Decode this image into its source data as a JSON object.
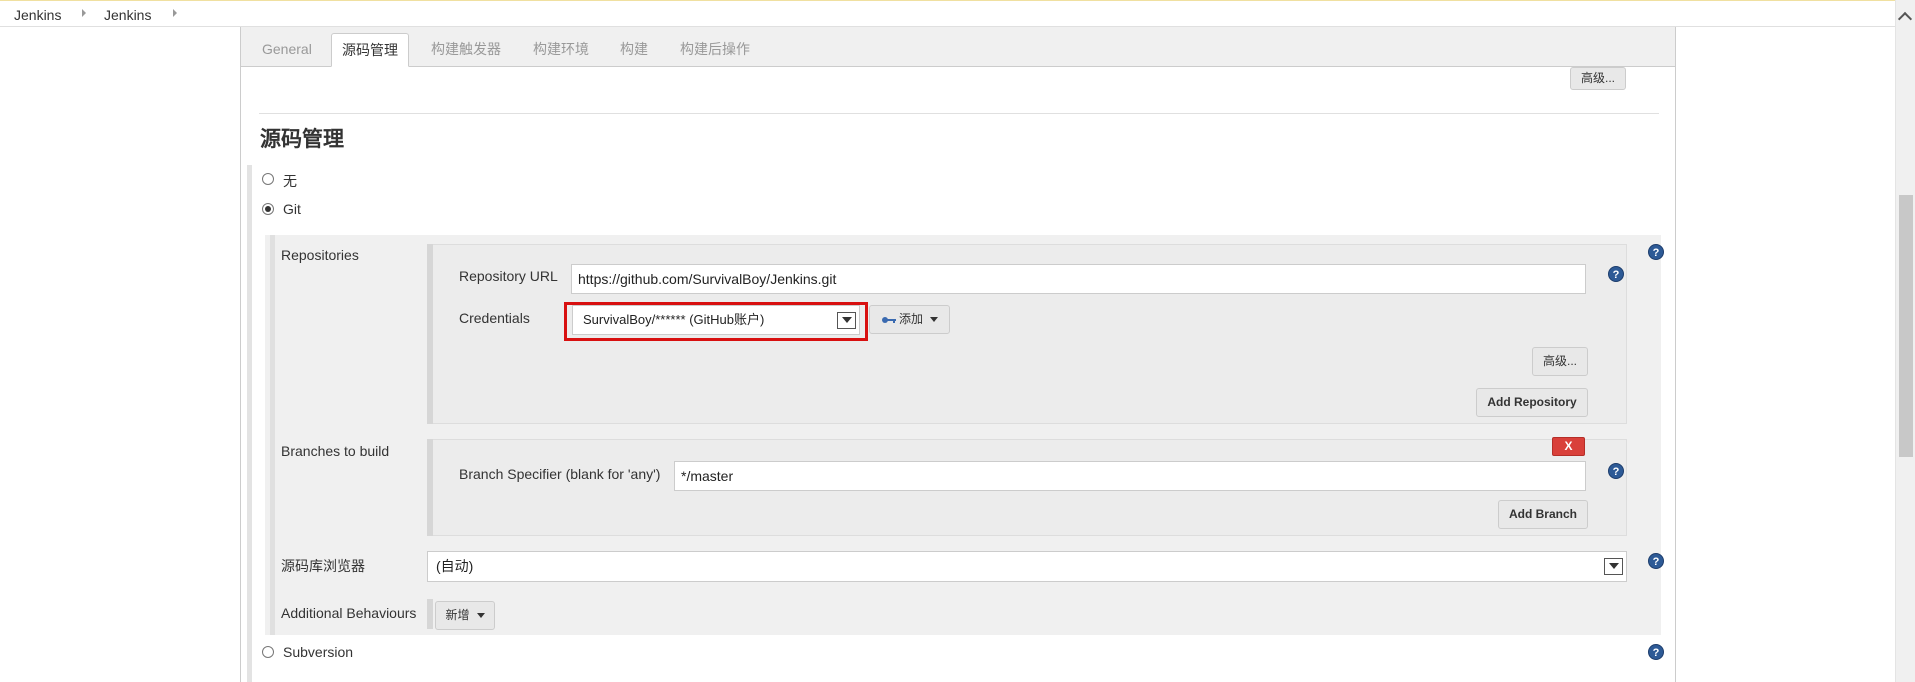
{
  "breadcrumb": [
    "Jenkins",
    "Jenkins"
  ],
  "tabs": [
    "General",
    "源码管理",
    "构建触发器",
    "构建环境",
    "构建",
    "构建后操作"
  ],
  "top_advanced_label": "高级...",
  "section_title": "源码管理",
  "scm_options": {
    "none": "无",
    "git": "Git",
    "svn": "Subversion",
    "selected": "Git"
  },
  "repositories": {
    "label": "Repositories",
    "url_label": "Repository URL",
    "url_value": "https://github.com/SurvivalBoy/Jenkins.git",
    "credentials_label": "Credentials",
    "credentials_value": "SurvivalBoy/****** (GitHub账户)",
    "add_label": "添加",
    "advanced_label": "高级...",
    "add_repository_label": "Add Repository"
  },
  "branches": {
    "label": "Branches to build",
    "delete_label": "X",
    "specifier_label": "Branch Specifier (blank for 'any')",
    "specifier_value": "*/master",
    "add_branch_label": "Add Branch"
  },
  "browser": {
    "label": "源码库浏览器",
    "value": "(自动)"
  },
  "additional": {
    "label": "Additional Behaviours",
    "add_label": "新增"
  },
  "help_glyph": "?",
  "colors": {
    "highlight": "#d81010",
    "help_icon": "#2d5a96",
    "delete": "#d9403a"
  }
}
